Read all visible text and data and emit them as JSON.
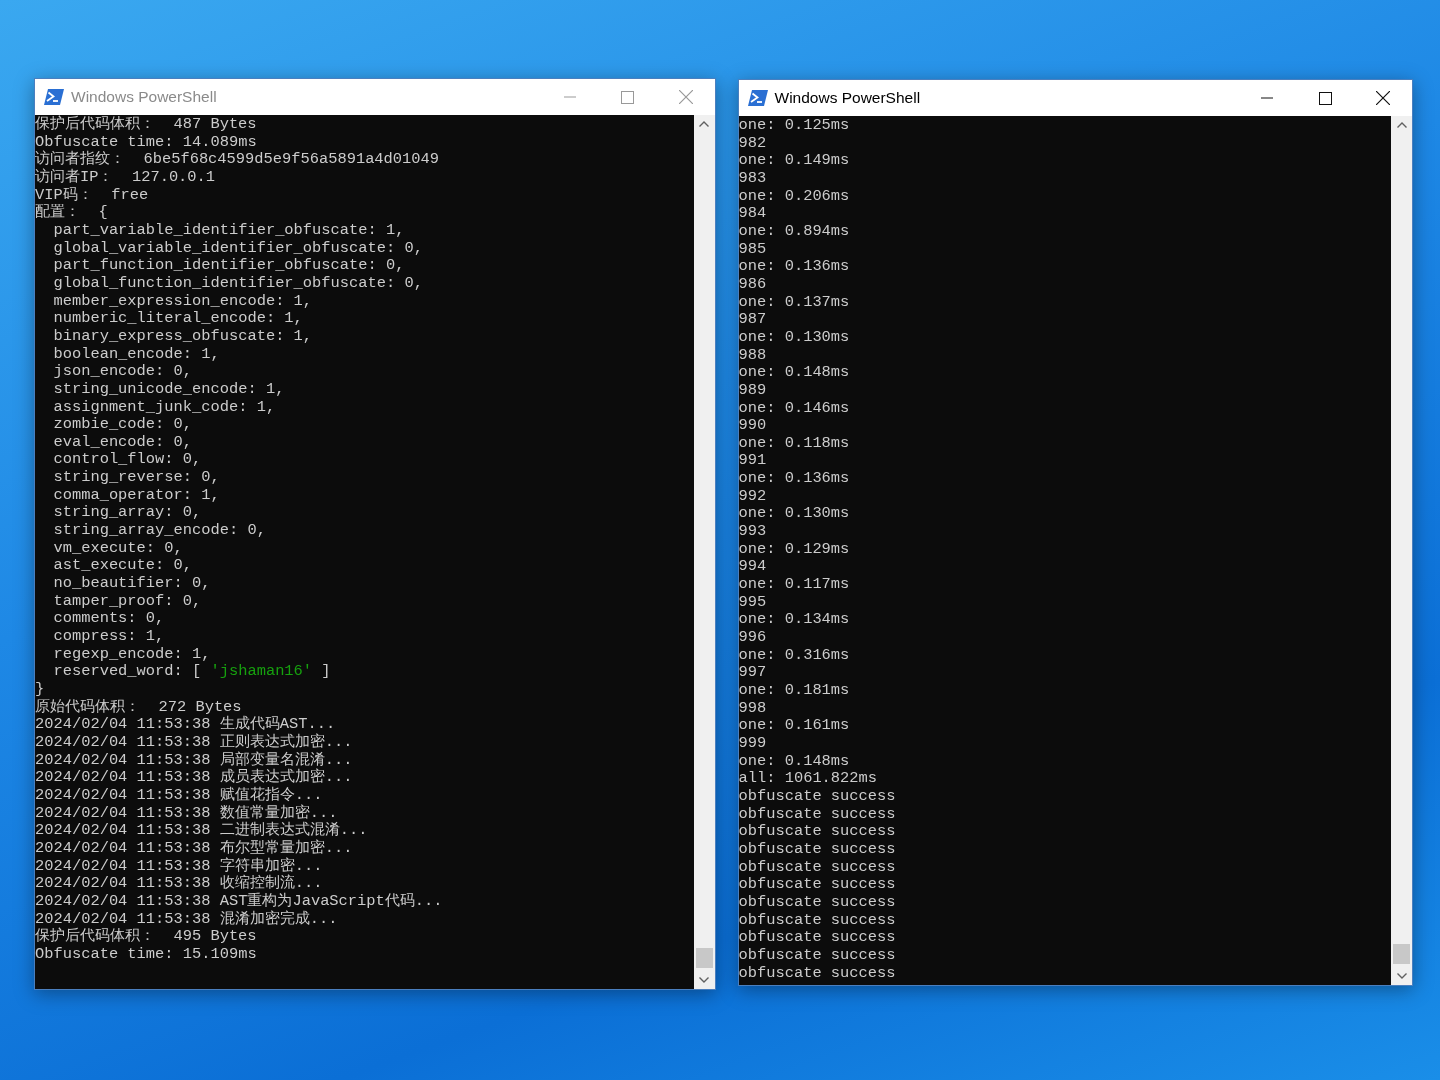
{
  "windows": [
    {
      "title": "Windows PowerShell",
      "active": false,
      "lines": [
        "保护后代码体积：  487 Bytes",
        "Obfuscate time: 14.089ms",
        "访问者指纹：  6be5f68c4599d5e9f56a5891a4d01049",
        "访问者IP：  127.0.0.1",
        "VIP码：  free",
        "配置：  {",
        "  part_variable_identifier_obfuscate: 1,",
        "  global_variable_identifier_obfuscate: 0,",
        "  part_function_identifier_obfuscate: 0,",
        "  global_function_identifier_obfuscate: 0,",
        "  member_expression_encode: 1,",
        "  numberic_literal_encode: 1,",
        "  binary_express_obfuscate: 1,",
        "  boolean_encode: 1,",
        "  json_encode: 0,",
        "  string_unicode_encode: 1,",
        "  assignment_junk_code: 1,",
        "  zombie_code: 0,",
        "  eval_encode: 0,",
        "  control_flow: 0,",
        "  string_reverse: 0,",
        "  comma_operator: 1,",
        "  string_array: 0,",
        "  string_array_encode: 0,",
        "  vm_execute: 0,",
        "  ast_execute: 0,",
        "  no_beautifier: 0,",
        "  tamper_proof: 0,",
        "  comments: 0,",
        "  compress: 1,",
        "  regexp_encode: 1,",
        {
          "segments": [
            {
              "text": "  reserved_word: [ ",
              "color": "#cccccc"
            },
            {
              "text": "'jshaman16'",
              "color": "#16a00e"
            },
            {
              "text": " ]",
              "color": "#cccccc"
            }
          ]
        },
        "}",
        "原始代码体积：  272 Bytes",
        "2024/02/04 11:53:38 生成代码AST...",
        "2024/02/04 11:53:38 正则表达式加密...",
        "2024/02/04 11:53:38 局部变量名混淆...",
        "2024/02/04 11:53:38 成员表达式加密...",
        "2024/02/04 11:53:38 赋值花指令...",
        "2024/02/04 11:53:38 数值常量加密...",
        "2024/02/04 11:53:38 二进制表达式混淆...",
        "2024/02/04 11:53:38 布尔型常量加密...",
        "2024/02/04 11:53:38 字符串加密...",
        "2024/02/04 11:53:38 收缩控制流...",
        "2024/02/04 11:53:38 AST重构为JavaScript代码...",
        "2024/02/04 11:53:38 混淆加密完成...",
        "保护后代码体积：  495 Bytes",
        "Obfuscate time: 15.109ms"
      ]
    },
    {
      "title": "Windows PowerShell",
      "active": true,
      "lines": [
        "one: 0.125ms",
        "982",
        "one: 0.149ms",
        "983",
        "one: 0.206ms",
        "984",
        "one: 0.894ms",
        "985",
        "one: 0.136ms",
        "986",
        "one: 0.137ms",
        "987",
        "one: 0.130ms",
        "988",
        "one: 0.148ms",
        "989",
        "one: 0.146ms",
        "990",
        "one: 0.118ms",
        "991",
        "one: 0.136ms",
        "992",
        "one: 0.130ms",
        "993",
        "one: 0.129ms",
        "994",
        "one: 0.117ms",
        "995",
        "one: 0.134ms",
        "996",
        "one: 0.316ms",
        "997",
        "one: 0.181ms",
        "998",
        "one: 0.161ms",
        "999",
        "one: 0.148ms",
        "all: 1061.822ms",
        "obfuscate success",
        "obfuscate success",
        "obfuscate success",
        "obfuscate success",
        "obfuscate success",
        "obfuscate success",
        "obfuscate success",
        "obfuscate success",
        "obfuscate success",
        "obfuscate success",
        "obfuscate success"
      ]
    }
  ]
}
